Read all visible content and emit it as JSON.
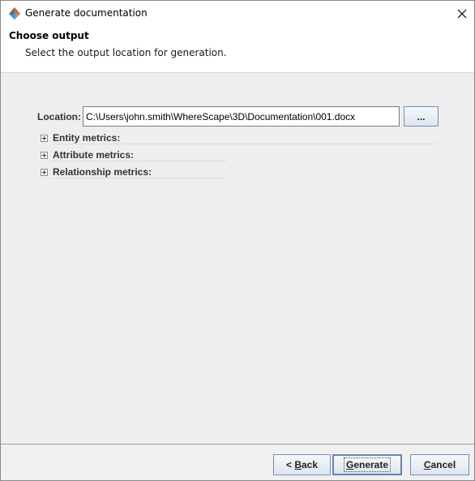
{
  "window": {
    "title": "Generate documentation",
    "close_symbol": "✕"
  },
  "header": {
    "title": "Choose output",
    "subtitle": "Select the output location for generation."
  },
  "location": {
    "label": "Location:",
    "value": "C:\\Users\\john.smith\\WhereScape\\3D\\Documentation\\001.docx",
    "browse_label": "..."
  },
  "metrics": [
    {
      "label": "Entity metrics:",
      "icon": "expand-plus-icon"
    },
    {
      "label": "Attribute metrics:",
      "icon": "expand-plus-icon"
    },
    {
      "label": "Relationship metrics:",
      "icon": "expand-plus-icon"
    }
  ],
  "footer": {
    "back": {
      "prefix": "< ",
      "mnemonic": "B",
      "rest": "ack"
    },
    "generate": {
      "mnemonic": "G",
      "rest": "enerate"
    },
    "cancel": {
      "mnemonic": "C",
      "rest": "ancel"
    }
  },
  "icons": {
    "app": "wherescape-app-icon",
    "close": "close-icon"
  }
}
